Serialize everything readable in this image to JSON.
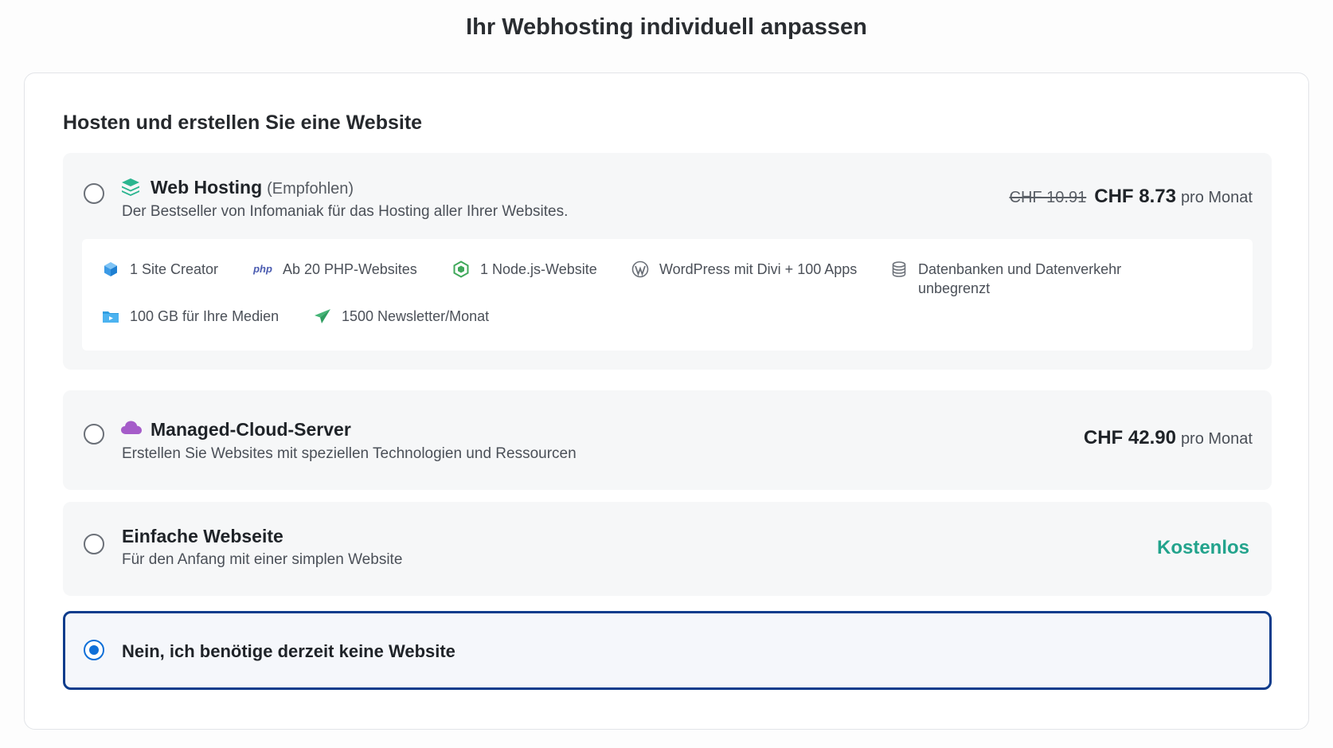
{
  "header": {
    "title": "Ihr Webhosting individuell anpassen"
  },
  "section": {
    "title": "Hosten und erstellen Sie eine Website"
  },
  "options": {
    "web_hosting": {
      "title": "Web Hosting",
      "note": "(Empfohlen)",
      "subtitle": "Der Bestseller von Infomaniak für das Hosting aller Ihrer Websites.",
      "old_price": "CHF 10.91",
      "price": "CHF 8.73",
      "period": "pro Monat",
      "selected": false,
      "features": [
        {
          "icon": "cube-icon",
          "label": "1 Site Creator"
        },
        {
          "icon": "php-icon",
          "icon_text": "php",
          "label": "Ab 20 PHP-Websites"
        },
        {
          "icon": "nodejs-icon",
          "label": "1 Node.js-Website"
        },
        {
          "icon": "wordpress-icon",
          "label": "WordPress mit Divi + 100 Apps"
        },
        {
          "icon": "database-icon",
          "label": "Datenbanken und Datenverkehr unbegrenzt"
        },
        {
          "icon": "media-folder-icon",
          "label": "100 GB für Ihre Medien"
        },
        {
          "icon": "paper-plane-icon",
          "label": "1500 Newsletter/Monat"
        }
      ]
    },
    "cloud_server": {
      "title": "Managed-Cloud-Server",
      "subtitle": "Erstellen Sie Websites mit speziellen Technologien und Ressourcen",
      "price": "CHF 42.90",
      "period": "pro Monat",
      "selected": false
    },
    "simple_site": {
      "title": "Einfache Webseite",
      "subtitle": "Für den Anfang mit einer simplen Website",
      "price": "Kostenlos",
      "selected": false
    },
    "no_site": {
      "title": "Nein, ich benötige derzeit keine Website",
      "selected": true
    }
  },
  "colors": {
    "accent": "#0f6fd8",
    "selected_border": "#0d3c8c",
    "free_green": "#22a38c",
    "web_hosting_icon": "#2bb58f",
    "cloud_icon": "#a55cc9"
  }
}
